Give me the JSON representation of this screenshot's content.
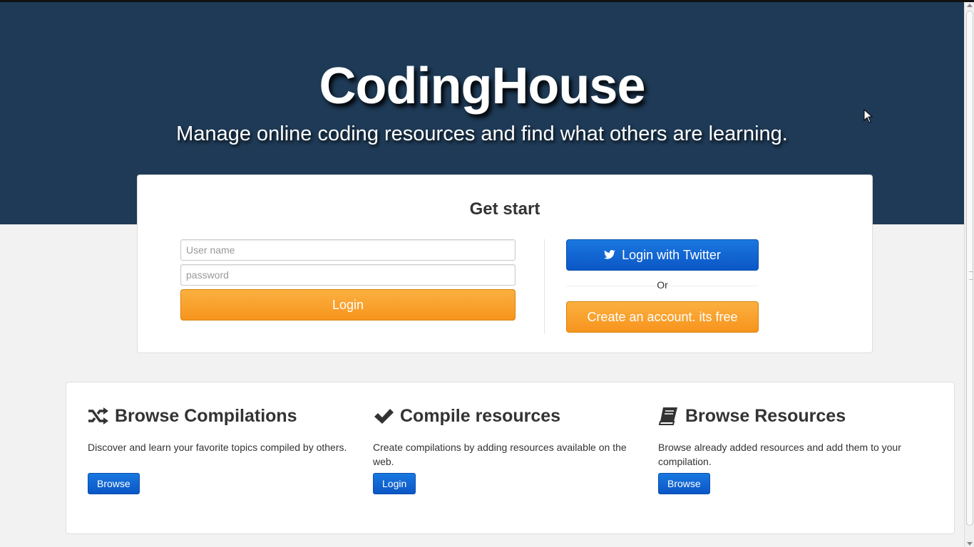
{
  "hero": {
    "title": "CodingHouse",
    "subtitle": "Manage online coding resources and find what others are learning."
  },
  "get_started": {
    "heading": "Get start",
    "username_placeholder": "User name",
    "password_placeholder": "password",
    "login_label": "Login",
    "twitter_label": "Login with Twitter",
    "or_label": "Or",
    "create_label": "Create an account. its free"
  },
  "features": [
    {
      "title": "Browse Compilations",
      "icon": "shuffle-icon",
      "description": "Discover and learn your favorite topics compiled by others.",
      "button": "Browse"
    },
    {
      "title": "Compile resources",
      "icon": "checkmark-icon",
      "description": "Create compilations by adding resources available on the web.",
      "button": "Login"
    },
    {
      "title": "Browse Resources",
      "icon": "book-icon",
      "description": "Browse already added resources and add them to your compilation.",
      "button": "Browse"
    }
  ],
  "colors": {
    "hero_background": "#1e3a56",
    "primary_orange": "#f7941d",
    "primary_blue": "#0b56c6",
    "page_background": "#f2f2f2"
  }
}
